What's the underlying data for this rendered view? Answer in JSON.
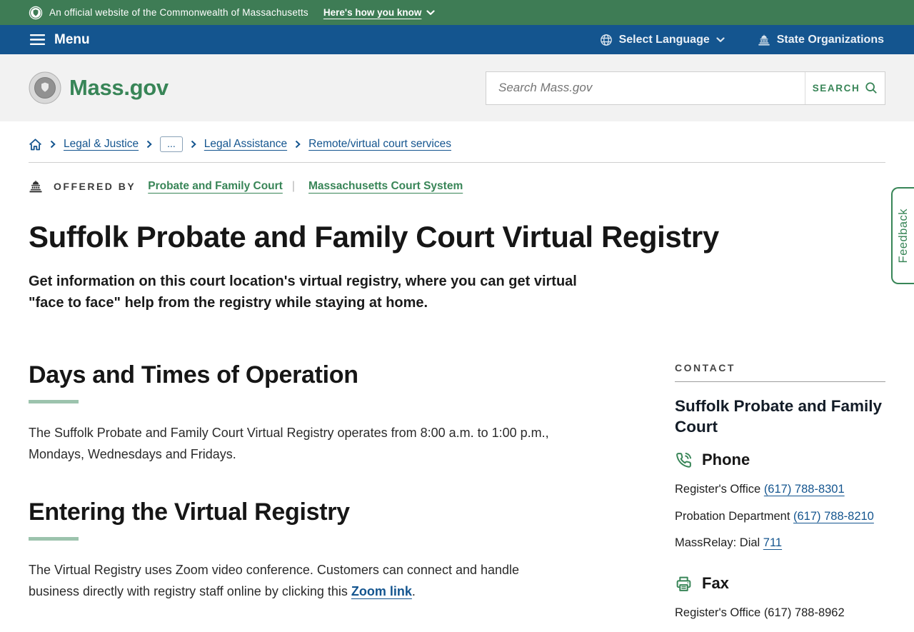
{
  "colors": {
    "banner_green": "#3e7c55",
    "nav_blue": "#14558f",
    "brand_green": "#388557",
    "link_blue": "#14558f",
    "accent_sage": "#9cc3ad",
    "header_gray": "#f2f2f2"
  },
  "banner": {
    "official": "An official website of the Commonwealth of Massachusetts",
    "how_you_know": "Here's how you know"
  },
  "navbar": {
    "menu": "Menu",
    "select_language": "Select Language",
    "state_organizations": "State Organizations"
  },
  "header": {
    "logo": "Mass.gov",
    "search": {
      "placeholder": "Search Mass.gov",
      "button": "SEARCH"
    }
  },
  "breadcrumb": {
    "items": [
      {
        "label": "Legal & Justice"
      },
      {
        "label": "..."
      },
      {
        "label": "Legal Assistance"
      },
      {
        "label": "Remote/virtual court services"
      }
    ]
  },
  "offered_by": {
    "label": "OFFERED BY",
    "divider": "|",
    "links": [
      {
        "label": "Probate and Family Court"
      },
      {
        "label": "Massachusetts Court System"
      }
    ]
  },
  "page": {
    "title": "Suffolk Probate and Family Court Virtual Registry",
    "subtitle": "Get information on this court location's virtual registry, where you can get virtual \"face to face\" help from the registry while staying at home."
  },
  "sections": [
    {
      "heading": "Days and Times of Operation",
      "body": "The Suffolk Probate and Family Court Virtual Registry operates from 8:00 a.m. to 1:00 p.m., Mondays, Wednesdays and Fridays."
    },
    {
      "heading": "Entering the Virtual Registry",
      "body_before_link": "The Virtual Registry uses Zoom video conference. Customers can connect and handle business directly with registry staff online by clicking this ",
      "link_text": "Zoom link",
      "body_after_link": "."
    }
  ],
  "contact": {
    "label": "CONTACT",
    "name": "Suffolk Probate and Family Court",
    "phone": {
      "heading": "Phone",
      "rows": [
        {
          "label": "Register's Office ",
          "value": "(617) 788-8301"
        },
        {
          "label": "Probation Department ",
          "value": "(617) 788-8210"
        },
        {
          "label": "MassRelay: Dial ",
          "value": "711"
        }
      ]
    },
    "fax": {
      "heading": "Fax",
      "rows": [
        {
          "label": "Register's Office ",
          "value": "(617) 788-8962"
        }
      ]
    }
  },
  "feedback": {
    "label": "Feedback"
  },
  "icons": [
    "seal-icon",
    "chevron-down-icon",
    "hamburger-icon",
    "globe-icon",
    "statehouse-icon",
    "search-icon",
    "home-icon",
    "chevron-right-icon",
    "phone-icon",
    "fax-icon"
  ]
}
